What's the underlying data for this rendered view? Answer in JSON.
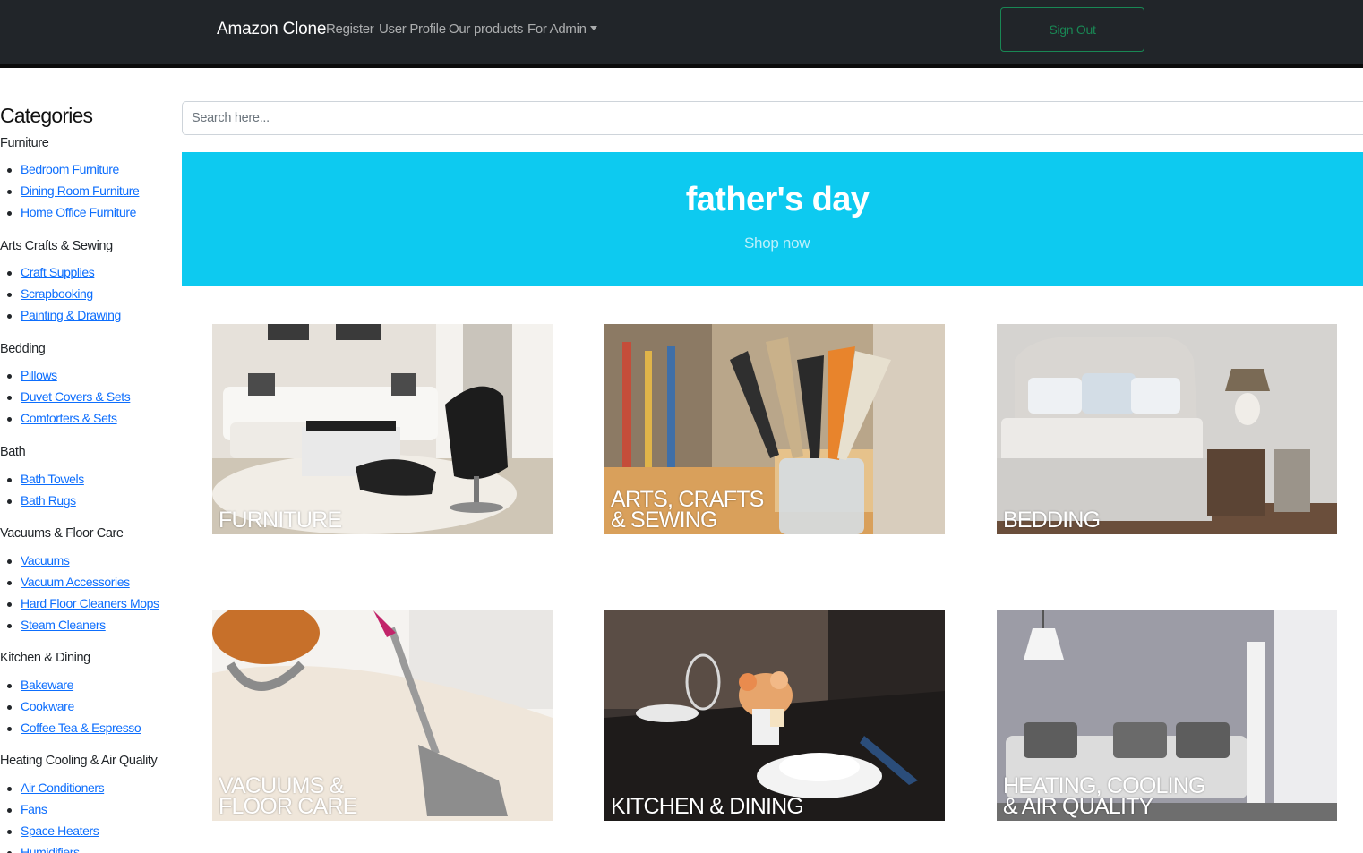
{
  "navbar": {
    "brand": "Amazon Clone",
    "links": {
      "register": "Register",
      "profile": "User Profile",
      "products": "Our products",
      "admin": "For Admin"
    },
    "sign_out": "Sign Out"
  },
  "sidebar": {
    "title": "Categories",
    "categories": [
      {
        "name": "Furniture",
        "items": [
          "Bedroom Furniture",
          "Dining Room Furniture",
          "Home Office Furniture"
        ]
      },
      {
        "name": "Arts Crafts & Sewing",
        "items": [
          "Craft Supplies",
          "Scrapbooking",
          "Painting & Drawing"
        ]
      },
      {
        "name": "Bedding",
        "items": [
          "Pillows",
          "Duvet Covers & Sets",
          "Comforters & Sets"
        ]
      },
      {
        "name": "Bath",
        "items": [
          "Bath Towels",
          "Bath Rugs"
        ]
      },
      {
        "name": "Vacuums & Floor Care",
        "items": [
          "Vacuums",
          "Vacuum Accessories",
          "Hard Floor Cleaners Mops",
          "Steam Cleaners"
        ]
      },
      {
        "name": "Kitchen & Dining",
        "items": [
          "Bakeware",
          "Cookware",
          "Coffee Tea & Espresso"
        ]
      },
      {
        "name": "Heating Cooling & Air Quality",
        "items": [
          "Air Conditioners",
          "Fans",
          "Space Heaters",
          "Humidifiers"
        ]
      }
    ]
  },
  "search": {
    "placeholder": "Search here..."
  },
  "banner": {
    "title": "father's day",
    "link": "Shop now",
    "color": "#0dcaf0"
  },
  "tiles": {
    "t1": "FURNITURE",
    "t2": "ARTS, CRAFTS\n& SEWING",
    "t3": "BEDDING",
    "t4": "VACUUMS &\nFLOOR CARE",
    "t5": "KITCHEN & DINING",
    "t6": "HEATING, COOLING\n& AIR QUALITY"
  },
  "colors": {
    "navbar": "#212529",
    "link": "#0d6efd",
    "sign_out": "#198754"
  }
}
